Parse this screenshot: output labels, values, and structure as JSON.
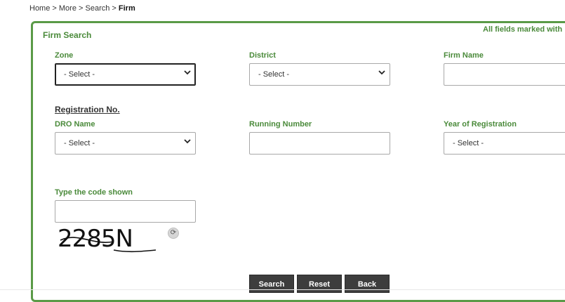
{
  "breadcrumb": {
    "home": "Home",
    "sep1": " > ",
    "more": "More",
    "sep2": " > ",
    "search": "Search",
    "sep3": " > ",
    "current": "Firm"
  },
  "panel": {
    "title": "Firm Search",
    "required_note": "All fields marked with"
  },
  "fields": {
    "zone": {
      "label": "Zone",
      "value": "- Select -"
    },
    "district": {
      "label": "District",
      "value": "- Select -"
    },
    "firm_name": {
      "label": "Firm Name",
      "value": ""
    },
    "registration_heading": "Registration No.",
    "dro_name": {
      "label": "DRO Name",
      "value": "- Select -"
    },
    "running_number": {
      "label": "Running Number",
      "value": ""
    },
    "year_of_registration": {
      "label": "Year of Registration",
      "value": "- Select -"
    },
    "captcha_code": {
      "label": "Type the code shown",
      "value": ""
    }
  },
  "captcha": {
    "text": "2285N",
    "refresh_icon": "refresh-icon"
  },
  "buttons": {
    "search": "Search",
    "reset": "Reset",
    "back": "Back"
  },
  "colors": {
    "accent": "#4a8a3a",
    "border": "#5a9a47",
    "button": "#3d3d3d"
  }
}
